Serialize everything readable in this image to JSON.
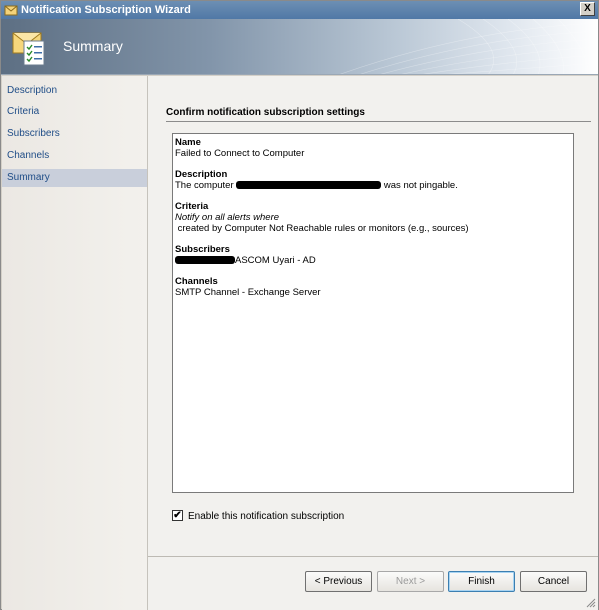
{
  "window": {
    "title": "Notification Subscription Wizard",
    "close_glyph": "X"
  },
  "banner": {
    "title": "Summary",
    "icon": "notification-envelope-icon"
  },
  "nav": {
    "items": [
      {
        "label": "Description",
        "selected": false
      },
      {
        "label": "Criteria",
        "selected": false
      },
      {
        "label": "Subscribers",
        "selected": false
      },
      {
        "label": "Channels",
        "selected": false
      },
      {
        "label": "Summary",
        "selected": true
      }
    ]
  },
  "main": {
    "section_title": "Confirm notification subscription settings",
    "summary": {
      "name": {
        "heading": "Name",
        "value": "Failed to Connect to Computer"
      },
      "description": {
        "heading": "Description",
        "prefix": "The computer",
        "suffix": "was not pingable."
      },
      "criteria": {
        "heading": "Criteria",
        "line1": "Notify on all alerts where",
        "line2": " created by Computer Not Reachable rules or monitors (e.g., sources)"
      },
      "subscribers": {
        "heading": "Subscribers",
        "suffix": "ASCOM Uyari - AD"
      },
      "channels": {
        "heading": "Channels",
        "value": "SMTP Channel - Exchange Server"
      }
    },
    "enable_checkbox": {
      "label": "Enable this notification subscription",
      "checked": true,
      "glyph": "✔"
    }
  },
  "buttons": {
    "previous": "< Previous",
    "next": "Next >",
    "finish": "Finish",
    "cancel": "Cancel"
  },
  "colors": {
    "nav_link": "#1f4d87",
    "nav_selected_bg": "#c9cfdb",
    "titlebar": "#5078a6"
  }
}
